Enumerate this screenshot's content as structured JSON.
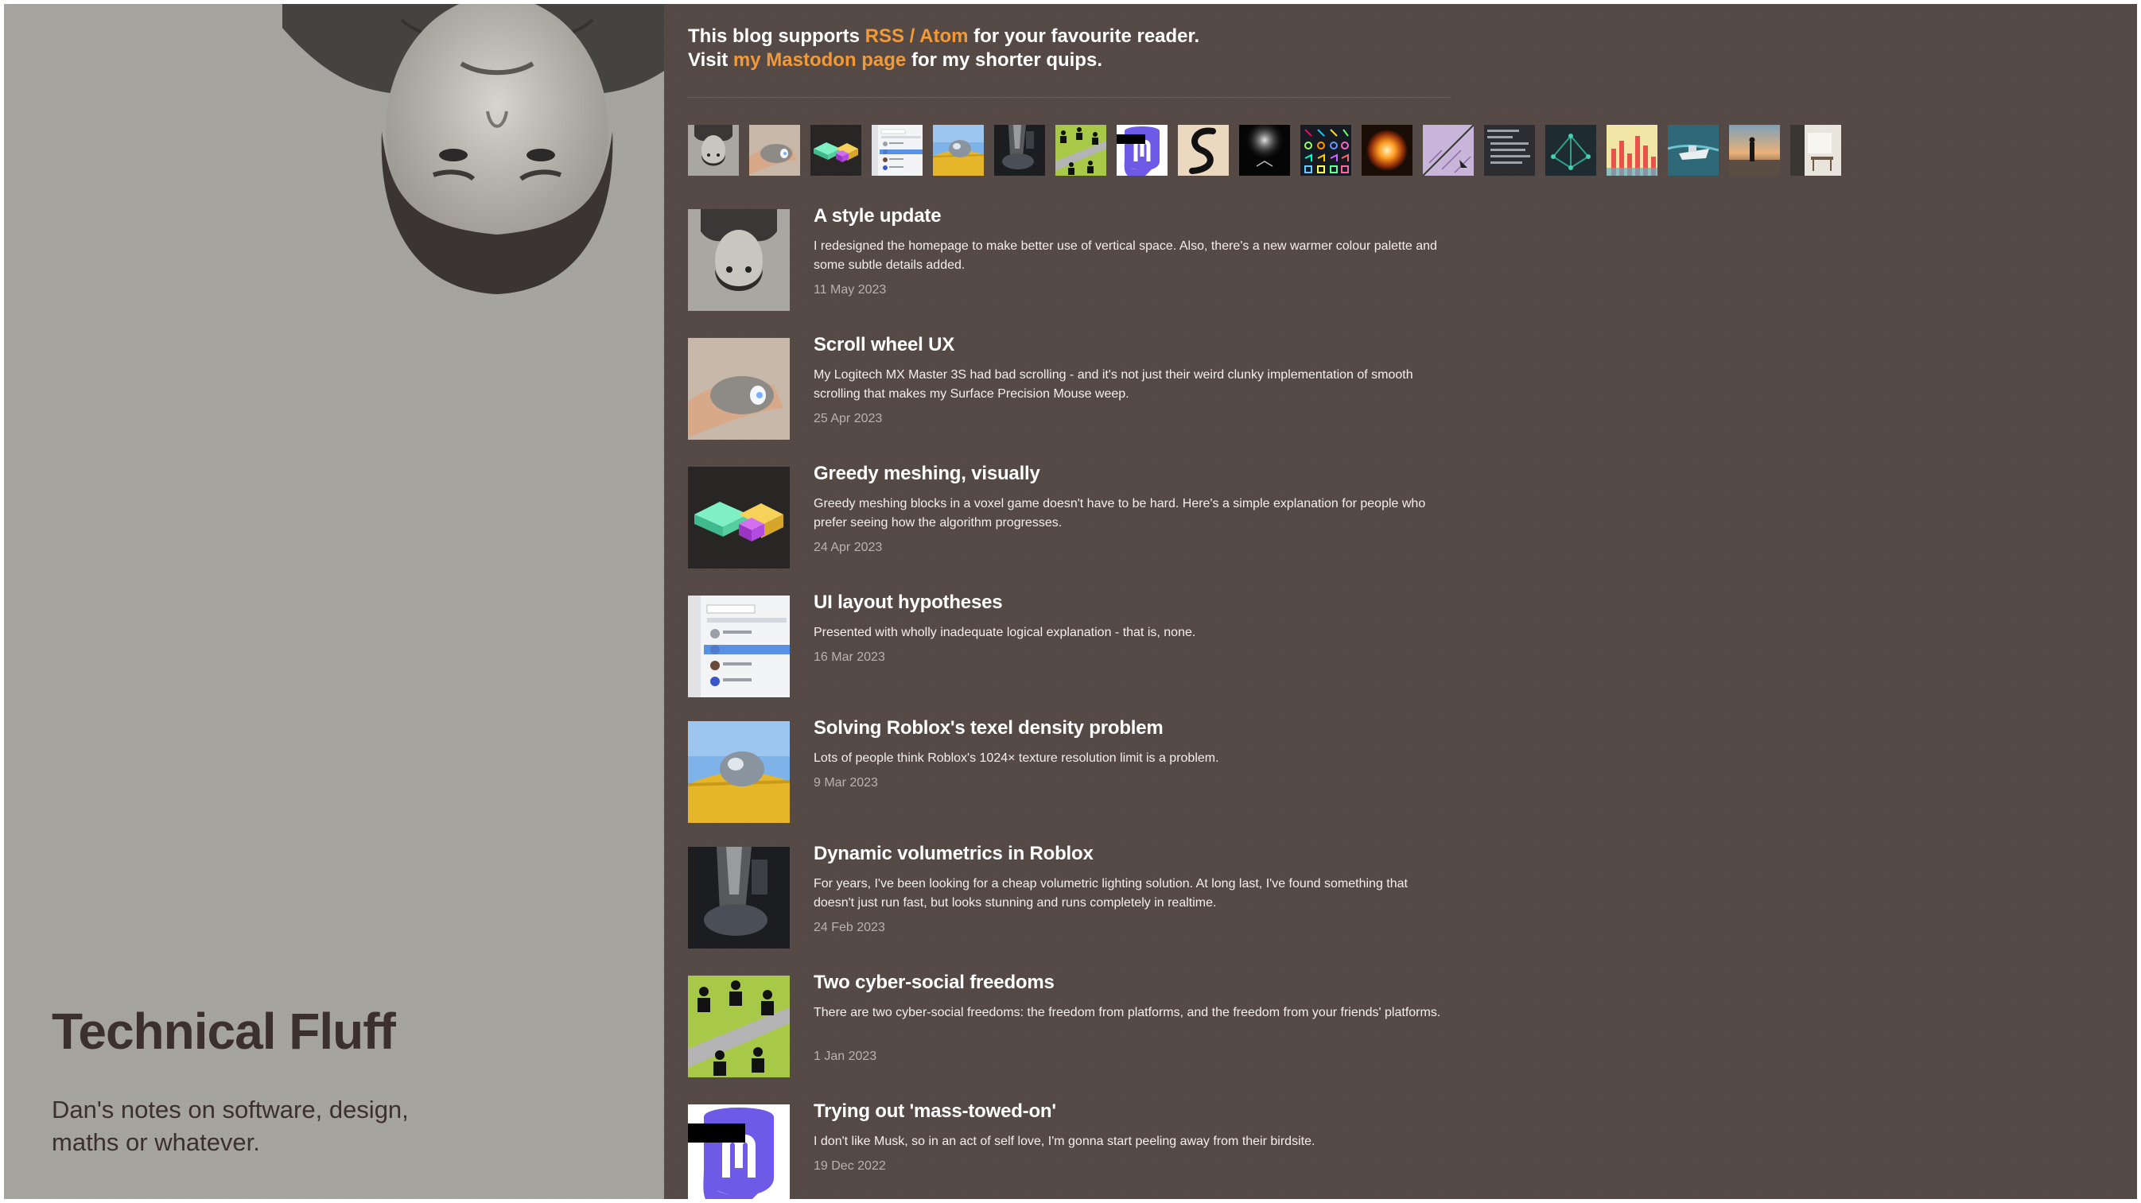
{
  "sidebar": {
    "title": "Technical Fluff",
    "subtitle": "Dan's notes on software, design, maths or whatever.",
    "portrait_icon": "portrait-photo-icon"
  },
  "intro": {
    "line1_prefix": "This blog supports ",
    "rss_link": "RSS / Atom",
    "line1_suffix": " for your favourite reader.",
    "line2_prefix": "Visit ",
    "mastodon_link": "my Mastodon page",
    "line2_suffix": " for my shorter quips."
  },
  "thumbnail_strip": [
    "portrait-thumb-icon",
    "mouse-thumb-icon",
    "voxel-thumb-icon",
    "ui-list-thumb-icon",
    "roblox-texel-thumb-icon",
    "volumetrics-thumb-icon",
    "freedoms-thumb-icon",
    "mastodon-thumb-icon",
    "serpent-thumb-icon",
    "spotlight-thumb-icon",
    "icon-grid-thumb-icon",
    "explosion-thumb-icon",
    "diagram-thumb-icon",
    "terminal-thumb-icon",
    "graph-thumb-icon",
    "heatmap-thumb-icon",
    "boat-thumb-icon",
    "sunset-thumb-icon",
    "room-thumb-icon"
  ],
  "posts": [
    {
      "title": "A style update",
      "description": "I redesigned the homepage to make better use of vertical space. Also, there's a new warmer colour palette and some subtle details added.",
      "date": "11 May 2023",
      "icon": "portrait-thumb-icon"
    },
    {
      "title": "Scroll wheel UX",
      "description": "My Logitech MX Master 3S had bad scrolling - and it's not just their weird clunky implementation of smooth scrolling that makes my Surface Precision Mouse weep.",
      "date": "25 Apr 2023",
      "icon": "mouse-thumb-icon"
    },
    {
      "title": "Greedy meshing, visually",
      "description": "Greedy meshing blocks in a voxel game doesn't have to be hard. Here's a simple explanation for people who prefer seeing how the algorithm progresses.",
      "date": "24 Apr 2023",
      "icon": "voxel-thumb-icon"
    },
    {
      "title": "UI layout hypotheses",
      "description": "Presented with wholly inadequate logical explanation - that is, none.",
      "date": "16 Mar 2023",
      "icon": "ui-list-thumb-icon"
    },
    {
      "title": "Solving Roblox's texel density problem",
      "description": "Lots of people think Roblox's 1024× texture resolution limit is a problem.",
      "date": "9 Mar 2023",
      "icon": "roblox-texel-thumb-icon"
    },
    {
      "title": "Dynamic volumetrics in Roblox",
      "description": "For years, I've been looking for a cheap volumetric lighting solution. At long last, I've found something that doesn't just run fast, but looks stunning and runs completely in realtime.",
      "date": "24 Feb 2023",
      "icon": "volumetrics-thumb-icon"
    },
    {
      "title": "Two cyber-social freedoms",
      "description": "There are two cyber-social freedoms: the freedom from platforms, and the freedom from your friends' platforms.",
      "date": "1 Jan 2023",
      "icon": "freedoms-thumb-icon"
    },
    {
      "title": "Trying out 'mass-towed-on'",
      "description": "I don't like Musk, so in an act of self love, I'm gonna start peeling away from their birdsite.",
      "date": "19 Dec 2022",
      "icon": "mastodon-thumb-icon"
    }
  ]
}
